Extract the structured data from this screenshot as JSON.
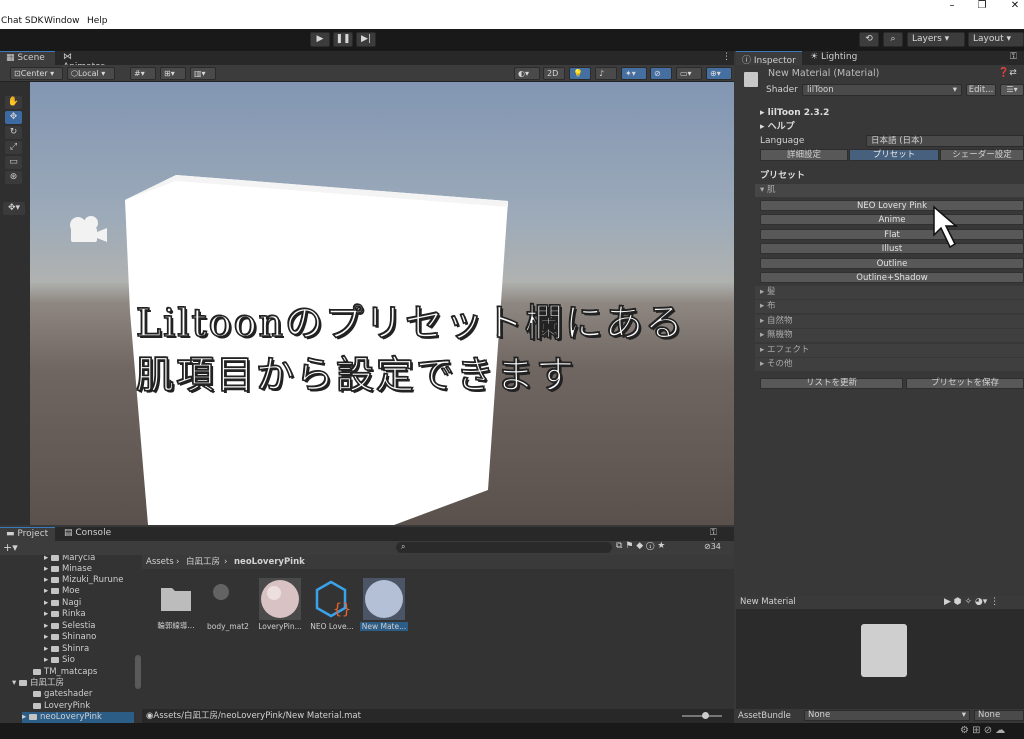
{
  "window": {
    "title_fragment": "Chat SDK"
  },
  "menu": {
    "items": [
      "Chat SDK",
      "Window",
      "Help"
    ]
  },
  "toolbar": {
    "layers": "Layers",
    "layout": "Layout"
  },
  "scene": {
    "tabs": [
      "Scene",
      "Animator"
    ],
    "pivot": "Center",
    "space": "Local",
    "mode2d": "2D",
    "overlay_line1": "Liltoonのプリセット欄にある",
    "overlay_line2": "肌項目から設定できます"
  },
  "inspector": {
    "tabs": [
      "Inspector",
      "Lighting"
    ],
    "material_name": "New Material (Material)",
    "shader_label": "Shader",
    "shader_value": "lilToon",
    "edit_button": "Edit...",
    "version": "lilToon 2.3.2",
    "help": "ヘルプ",
    "language_label": "Language",
    "language_value": "日本語 (日本)",
    "mode_tabs": [
      "詳細設定",
      "プリセット",
      "シェーダー設定"
    ],
    "preset_header": "プリセット",
    "skin_group": "肌",
    "skin_presets": [
      "NEO Lovery Pink",
      "Anime",
      "Flat",
      "Illust",
      "Outline",
      "Outline+Shadow"
    ],
    "other_groups": [
      "髪",
      "布",
      "自然物",
      "無機物",
      "エフェクト",
      "その他"
    ],
    "refresh_button": "リストを更新",
    "save_button": "プリセットを保存"
  },
  "preview": {
    "title": "New Material"
  },
  "assetbundle": {
    "label": "AssetBundle",
    "value": "None",
    "variant": "None"
  },
  "project": {
    "tabs": [
      "Project",
      "Console"
    ],
    "hidden_count": "34",
    "tree": [
      "Marycia",
      "Minase",
      "Mizuki_Rurune",
      "Moe",
      "Nagi",
      "Rinka",
      "Selestia",
      "Shinano",
      "Shinra",
      "Sio",
      "TM_matcaps",
      "白凪工房",
      "gateshader",
      "LoveryPink",
      "neoLoveryPink"
    ],
    "breadcrumb": [
      "Assets",
      "白凪工房",
      "neoLoveryPink"
    ],
    "assets": [
      "輪郭線導...",
      "body_mat2",
      "LoveryPin...",
      "NEO Love...",
      "New Mate..."
    ],
    "path": "Assets/白凪工房/neoLoveryPink/New Material.mat"
  }
}
